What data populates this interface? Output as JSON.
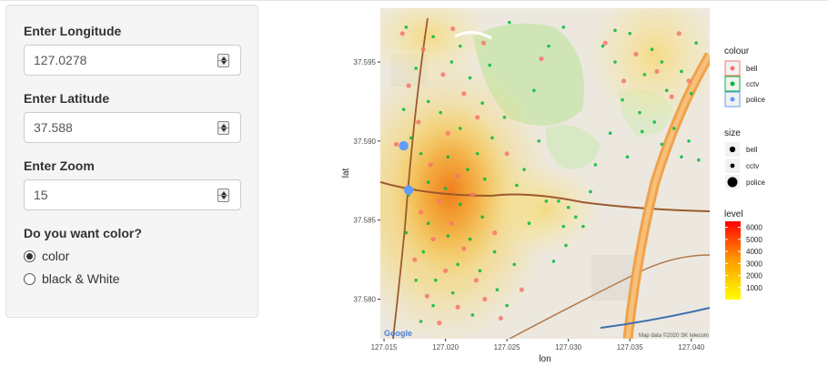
{
  "controls": {
    "longitude": {
      "label": "Enter Longitude",
      "value": "127.0278"
    },
    "latitude": {
      "label": "Enter Latitude",
      "value": "37.588"
    },
    "zoom": {
      "label": "Enter Zoom",
      "value": "15"
    },
    "color_question": "Do you want color?",
    "color_options": [
      {
        "label": "color",
        "selected": true
      },
      {
        "label": "black & White",
        "selected": false
      }
    ]
  },
  "map": {
    "attribution": "Map data ©2020 SK telecom",
    "google_logo": "Google"
  },
  "chart_data": {
    "type": "scatter",
    "xlabel": "lon",
    "ylabel": "lat",
    "xlim": [
      127.0147,
      127.0415
    ],
    "ylim": [
      37.5775,
      37.5984
    ],
    "x_ticks": [
      127.015,
      127.02,
      127.025,
      127.03,
      127.035,
      127.04
    ],
    "x_tick_labels": [
      "127.015",
      "127.020",
      "127.025",
      "127.030",
      "127.035",
      "127.040"
    ],
    "y_ticks": [
      37.58,
      37.585,
      37.59,
      37.595
    ],
    "y_tick_labels": [
      "37.580",
      "37.585",
      "37.590",
      "37.595"
    ],
    "background": "map tiles",
    "series": [
      {
        "name": "bell",
        "color": "#F8766D",
        "points": [
          [
            127.0165,
            37.5968
          ],
          [
            127.0182,
            37.5958
          ],
          [
            127.0206,
            37.5971
          ],
          [
            127.0231,
            37.5962
          ],
          [
            127.017,
            37.5935
          ],
          [
            127.0198,
            37.5942
          ],
          [
            127.0215,
            37.593
          ],
          [
            127.0178,
            37.5912
          ],
          [
            127.0202,
            37.5905
          ],
          [
            127.0226,
            37.5915
          ],
          [
            127.0188,
            37.5885
          ],
          [
            127.021,
            37.5878
          ],
          [
            127.0195,
            37.5862
          ],
          [
            127.018,
            37.5855
          ],
          [
            127.0222,
            37.5866
          ],
          [
            127.0205,
            37.5848
          ],
          [
            127.019,
            37.5838
          ],
          [
            127.0215,
            37.5832
          ],
          [
            127.0175,
            37.5825
          ],
          [
            127.02,
            37.5818
          ],
          [
            127.0225,
            37.5812
          ],
          [
            127.0185,
            37.5802
          ],
          [
            127.021,
            37.5795
          ],
          [
            127.0232,
            37.58
          ],
          [
            127.0195,
            37.5785
          ],
          [
            127.0245,
            37.5788
          ],
          [
            127.0262,
            37.5806
          ],
          [
            127.024,
            37.5842
          ],
          [
            127.016,
            37.5898
          ],
          [
            127.025,
            37.5892
          ],
          [
            127.033,
            37.5962
          ],
          [
            127.0355,
            37.5955
          ],
          [
            127.0372,
            37.5944
          ],
          [
            127.0398,
            37.5938
          ],
          [
            127.0345,
            37.5938
          ],
          [
            127.0384,
            37.5928
          ],
          [
            127.039,
            37.5968
          ],
          [
            127.0278,
            37.5952
          ]
        ]
      },
      {
        "name": "cctv",
        "color": "#00BA38",
        "points": [
          [
            127.0168,
            37.5972
          ],
          [
            127.019,
            37.5966
          ],
          [
            127.0212,
            37.596
          ],
          [
            127.0236,
            37.5948
          ],
          [
            127.0176,
            37.5946
          ],
          [
            127.0205,
            37.595
          ],
          [
            127.022,
            37.594
          ],
          [
            127.0186,
            37.5925
          ],
          [
            127.0166,
            37.592
          ],
          [
            127.023,
            37.5924
          ],
          [
            127.0196,
            37.5918
          ],
          [
            127.0212,
            37.5908
          ],
          [
            127.0172,
            37.5902
          ],
          [
            127.0238,
            37.5902
          ],
          [
            127.0226,
            37.5892
          ],
          [
            127.018,
            37.5892
          ],
          [
            127.0202,
            37.589
          ],
          [
            127.0218,
            37.5882
          ],
          [
            127.0186,
            37.5874
          ],
          [
            127.0232,
            37.5876
          ],
          [
            127.02,
            37.587
          ],
          [
            127.017,
            37.5866
          ],
          [
            127.0212,
            37.586
          ],
          [
            127.0186,
            37.5848
          ],
          [
            127.023,
            37.5852
          ],
          [
            127.0202,
            37.584
          ],
          [
            127.0168,
            37.5842
          ],
          [
            127.022,
            37.5838
          ],
          [
            127.0182,
            37.583
          ],
          [
            127.024,
            37.583
          ],
          [
            127.021,
            37.5822
          ],
          [
            127.0192,
            37.5812
          ],
          [
            127.0228,
            37.5818
          ],
          [
            127.0176,
            37.5812
          ],
          [
            127.0206,
            37.5804
          ],
          [
            127.0242,
            37.5806
          ],
          [
            127.019,
            37.5796
          ],
          [
            127.0222,
            37.579
          ],
          [
            127.018,
            37.5786
          ],
          [
            127.025,
            37.5796
          ],
          [
            127.0256,
            37.5822
          ],
          [
            127.0268,
            37.5848
          ],
          [
            127.0258,
            37.5872
          ],
          [
            127.0248,
            37.5915
          ],
          [
            127.0276,
            37.59
          ],
          [
            127.0264,
            37.5882
          ],
          [
            127.0282,
            37.5862
          ],
          [
            127.0296,
            37.5846
          ],
          [
            127.0306,
            37.5852
          ],
          [
            127.03,
            37.5858
          ],
          [
            127.0292,
            37.5862
          ],
          [
            127.0298,
            37.5834
          ],
          [
            127.0318,
            37.5868
          ],
          [
            127.0322,
            37.5885
          ],
          [
            127.0334,
            37.5905
          ],
          [
            127.0328,
            37.596
          ],
          [
            127.0338,
            37.595
          ],
          [
            127.035,
            37.5968
          ],
          [
            127.0362,
            37.5942
          ],
          [
            127.0368,
            37.5958
          ],
          [
            127.0376,
            37.595
          ],
          [
            127.038,
            37.5932
          ],
          [
            127.0392,
            37.5944
          ],
          [
            127.04,
            37.593
          ],
          [
            127.0404,
            37.5962
          ],
          [
            127.0344,
            37.5926
          ],
          [
            127.0358,
            37.5918
          ],
          [
            127.037,
            37.5912
          ],
          [
            127.0386,
            37.5908
          ],
          [
            127.0398,
            37.59
          ],
          [
            127.0406,
            37.5888
          ],
          [
            127.0392,
            37.589
          ],
          [
            127.0376,
            37.5898
          ],
          [
            127.036,
            37.5906
          ],
          [
            127.0284,
            37.596
          ],
          [
            127.0296,
            37.5972
          ],
          [
            127.0252,
            37.5975
          ],
          [
            127.0272,
            37.5932
          ],
          [
            127.0338,
            37.597
          ],
          [
            127.0348,
            37.589
          ],
          [
            127.0312,
            37.5846
          ],
          [
            127.0288,
            37.5824
          ]
        ]
      },
      {
        "name": "police",
        "color": "#619CFF",
        "points": [
          [
            127.0166,
            37.5897
          ],
          [
            127.017,
            37.5869
          ]
        ]
      }
    ],
    "density": {
      "fill": "level",
      "range": [
        0,
        6000
      ],
      "colors": [
        "#FFFF00",
        "#FF0000"
      ]
    },
    "legends": [
      {
        "title": "colour",
        "entries": [
          "bell",
          "cctv",
          "police"
        ]
      },
      {
        "title": "size",
        "entries": [
          "bell",
          "cctv",
          "police"
        ]
      },
      {
        "title": "level",
        "ticks": [
          1000,
          2000,
          3000,
          4000,
          5000,
          6000
        ],
        "tick_labels": [
          "1000",
          "2000",
          "3000",
          "4000",
          "5000",
          "6000"
        ],
        "range": [
          0,
          6500
        ]
      }
    ],
    "legend_position": "right"
  }
}
